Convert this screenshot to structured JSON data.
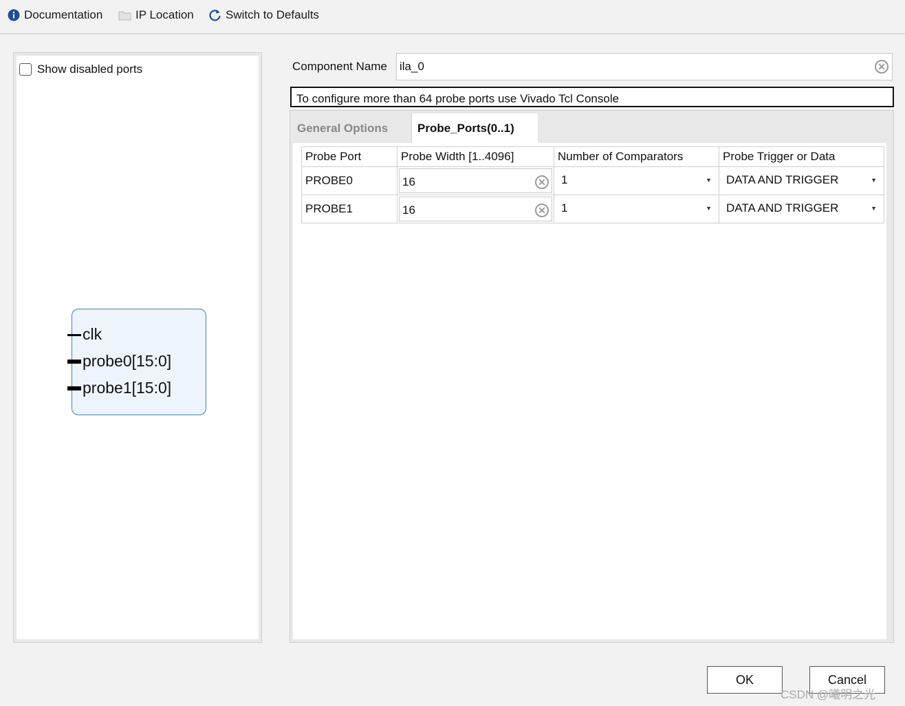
{
  "toolbar": {
    "documentation": "Documentation",
    "ip_location": "IP Location",
    "switch_defaults": "Switch to Defaults"
  },
  "left": {
    "show_disabled_label": "Show disabled ports",
    "show_disabled_checked": false,
    "ports": [
      "clk",
      "probe0[15:0]",
      "probe1[15:0]"
    ]
  },
  "component": {
    "label": "Component Name",
    "value": "ila_0"
  },
  "info_message": "To configure more than 64 probe ports use Vivado Tcl Console",
  "tabs": [
    "General Options",
    "Probe_Ports(0..1)"
  ],
  "active_tab": "Probe_Ports(0..1)",
  "table": {
    "headers": [
      "Probe Port",
      "Probe Width [1..4096]",
      "Number of Comparators",
      "Probe Trigger or Data"
    ],
    "rows": [
      {
        "port": "PROBE0",
        "width": "16",
        "comparators": "1",
        "trigger": "DATA AND TRIGGER"
      },
      {
        "port": "PROBE1",
        "width": "16",
        "comparators": "1",
        "trigger": "DATA AND TRIGGER"
      }
    ]
  },
  "buttons": {
    "ok": "OK",
    "cancel": "Cancel"
  },
  "watermark": "CSDN @曦明之光"
}
